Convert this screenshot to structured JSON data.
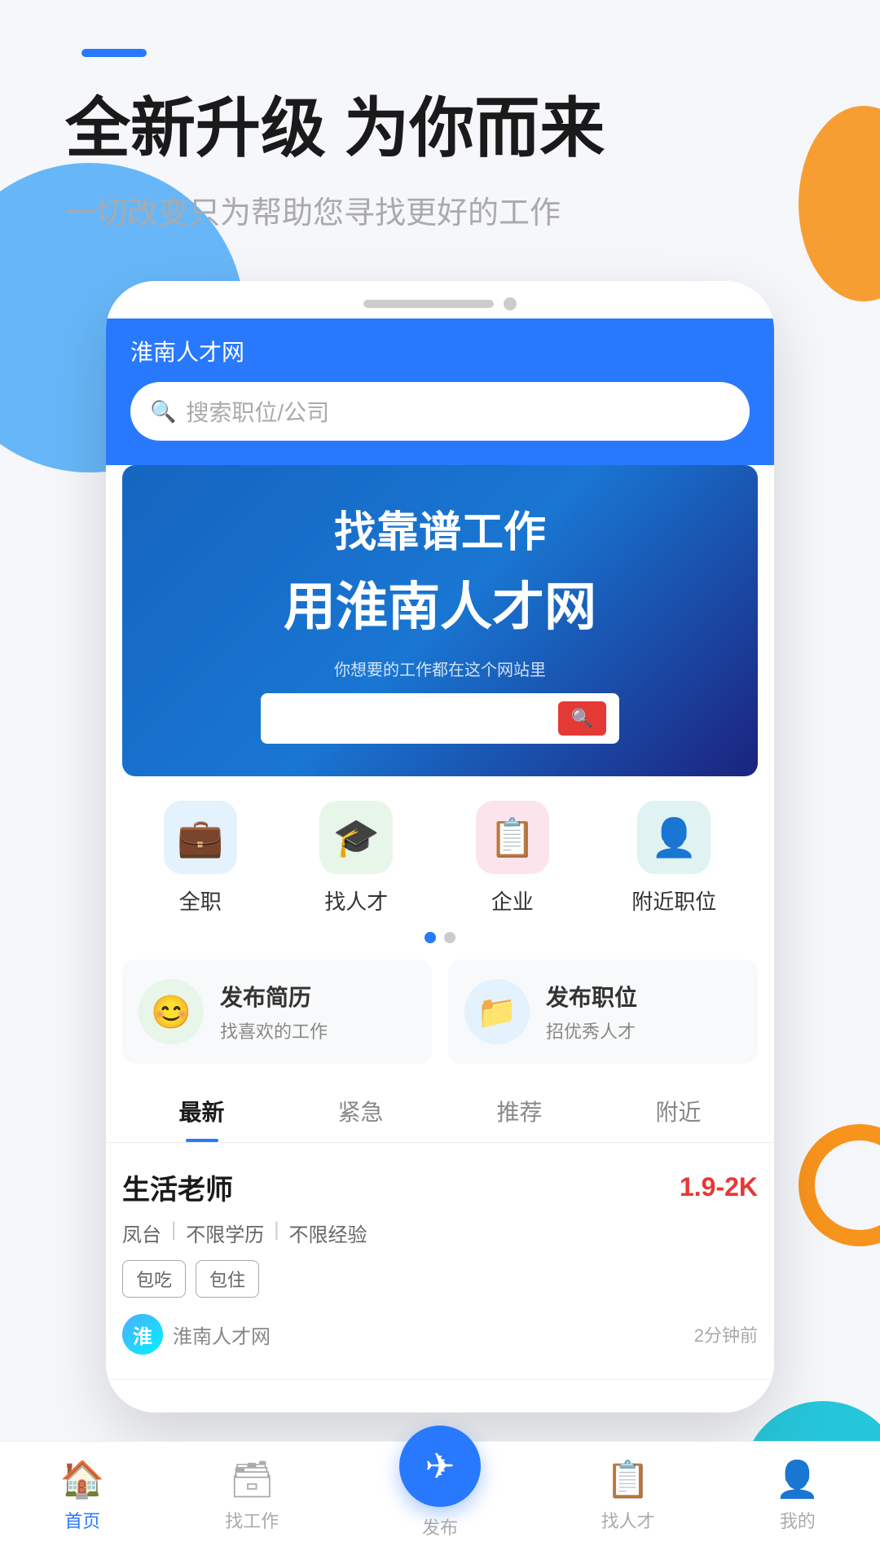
{
  "app": {
    "name": "淮南人才网"
  },
  "hero": {
    "title": "全新升级 为你而来",
    "subtitle": "一切改变只为帮助您寻找更好的工作"
  },
  "search": {
    "placeholder": "搜索职位/公司"
  },
  "banner": {
    "line1": "找靠谱工作",
    "line2": "用淮南人才网",
    "sub": "你想要的工作都在这个网站里"
  },
  "categories": [
    {
      "label": "全职",
      "icon": "💼",
      "color_class": "icon-blue"
    },
    {
      "label": "找人才",
      "icon": "🎓",
      "color_class": "icon-green"
    },
    {
      "label": "企业",
      "icon": "📋",
      "color_class": "icon-red"
    },
    {
      "label": "附近职位",
      "icon": "👤",
      "color_class": "icon-teal"
    }
  ],
  "action_cards": [
    {
      "title": "发布简历",
      "subtitle": "找喜欢的工作",
      "icon": "😊",
      "icon_class": "action-card-icon-green"
    },
    {
      "title": "发布职位",
      "subtitle": "招优秀人才",
      "icon": "📁",
      "icon_class": "action-card-icon-blue"
    }
  ],
  "tabs": [
    {
      "label": "最新",
      "active": true
    },
    {
      "label": "紧急",
      "active": false
    },
    {
      "label": "推荐",
      "active": false
    },
    {
      "label": "附近",
      "active": false
    }
  ],
  "job": {
    "title": "生活老师",
    "salary": "1.9-2K",
    "location": "凤台",
    "education": "不限学历",
    "experience": "不限经验",
    "badges": [
      "包吃",
      "包住"
    ],
    "company": "淮南人才网",
    "time": "2分钟前"
  },
  "bottom_nav": [
    {
      "label": "首页",
      "icon": "🏠",
      "active": true
    },
    {
      "label": "找工作",
      "icon": "🗃",
      "active": false
    },
    {
      "label": "发布",
      "icon": "➤",
      "active": false,
      "is_publish": true
    },
    {
      "label": "找人才",
      "icon": "📋",
      "active": false
    },
    {
      "label": "我的",
      "icon": "👤",
      "active": false
    }
  ]
}
